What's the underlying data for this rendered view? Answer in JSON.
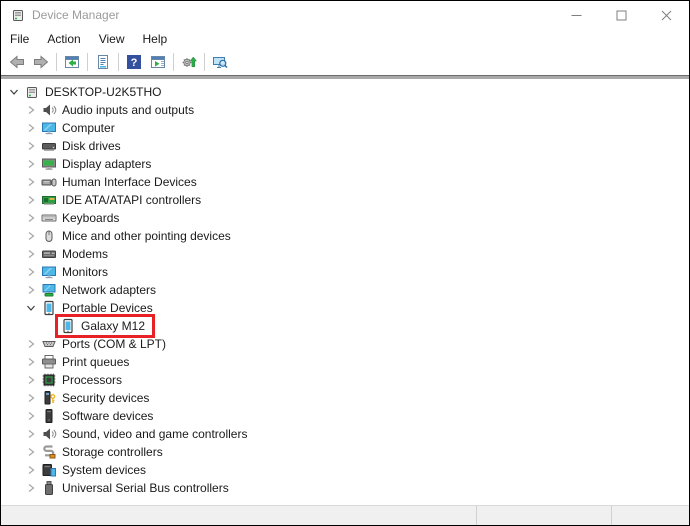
{
  "window": {
    "title": "Device Manager"
  },
  "titlebar_controls": {
    "minimize_icon": "minimize-icon",
    "maximize_icon": "maximize-icon",
    "close_icon": "close-icon"
  },
  "menubar": {
    "items": [
      "File",
      "Action",
      "View",
      "Help"
    ]
  },
  "toolbar": {
    "items": [
      {
        "type": "button",
        "icon": "back-icon"
      },
      {
        "type": "button",
        "icon": "forward-icon"
      },
      {
        "type": "sep"
      },
      {
        "type": "button",
        "icon": "console-tree-icon"
      },
      {
        "type": "sep"
      },
      {
        "type": "button",
        "icon": "properties-icon"
      },
      {
        "type": "sep"
      },
      {
        "type": "button",
        "icon": "help-icon"
      },
      {
        "type": "button",
        "icon": "action-pane-icon"
      },
      {
        "type": "sep"
      },
      {
        "type": "button",
        "icon": "update-driver-icon"
      },
      {
        "type": "sep"
      },
      {
        "type": "button",
        "icon": "scan-hardware-icon"
      }
    ]
  },
  "tree": {
    "items": [
      {
        "label": "DESKTOP-U2K5THO",
        "level": 0,
        "state": "expanded",
        "icon": "computer-root"
      },
      {
        "label": "Audio inputs and outputs",
        "level": 1,
        "state": "collapsed",
        "icon": "audio"
      },
      {
        "label": "Computer",
        "level": 1,
        "state": "collapsed",
        "icon": "monitor"
      },
      {
        "label": "Disk drives",
        "level": 1,
        "state": "collapsed",
        "icon": "disk"
      },
      {
        "label": "Display adapters",
        "level": 1,
        "state": "collapsed",
        "icon": "display-adapter"
      },
      {
        "label": "Human Interface Devices",
        "level": 1,
        "state": "collapsed",
        "icon": "hid"
      },
      {
        "label": "IDE ATA/ATAPI controllers",
        "level": 1,
        "state": "collapsed",
        "icon": "ide"
      },
      {
        "label": "Keyboards",
        "level": 1,
        "state": "collapsed",
        "icon": "keyboard"
      },
      {
        "label": "Mice and other pointing devices",
        "level": 1,
        "state": "collapsed",
        "icon": "mouse"
      },
      {
        "label": "Modems",
        "level": 1,
        "state": "collapsed",
        "icon": "modem"
      },
      {
        "label": "Monitors",
        "level": 1,
        "state": "collapsed",
        "icon": "monitor"
      },
      {
        "label": "Network adapters",
        "level": 1,
        "state": "collapsed",
        "icon": "network"
      },
      {
        "label": "Portable Devices",
        "level": 1,
        "state": "expanded",
        "icon": "phone"
      },
      {
        "label": "Galaxy M12",
        "level": 2,
        "state": "none",
        "icon": "phone",
        "highlighted": true
      },
      {
        "label": "Ports (COM & LPT)",
        "level": 1,
        "state": "collapsed",
        "icon": "ports"
      },
      {
        "label": "Print queues",
        "level": 1,
        "state": "collapsed",
        "icon": "printer"
      },
      {
        "label": "Processors",
        "level": 1,
        "state": "collapsed",
        "icon": "processor"
      },
      {
        "label": "Security devices",
        "level": 1,
        "state": "collapsed",
        "icon": "security"
      },
      {
        "label": "Software devices",
        "level": 1,
        "state": "collapsed",
        "icon": "software"
      },
      {
        "label": "Sound, video and game controllers",
        "level": 1,
        "state": "collapsed",
        "icon": "audio"
      },
      {
        "label": "Storage controllers",
        "level": 1,
        "state": "collapsed",
        "icon": "storage"
      },
      {
        "label": "System devices",
        "level": 1,
        "state": "collapsed",
        "icon": "system"
      },
      {
        "label": "Universal Serial Bus controllers",
        "level": 1,
        "state": "collapsed",
        "icon": "usb"
      }
    ]
  },
  "colors": {
    "highlight_red": "#e82127",
    "titlebar_text": "#9b9b9b",
    "tree_blue": "#4db8e8",
    "tree_green": "#2dae49",
    "statusbar_bg": "#f0f0f0"
  }
}
